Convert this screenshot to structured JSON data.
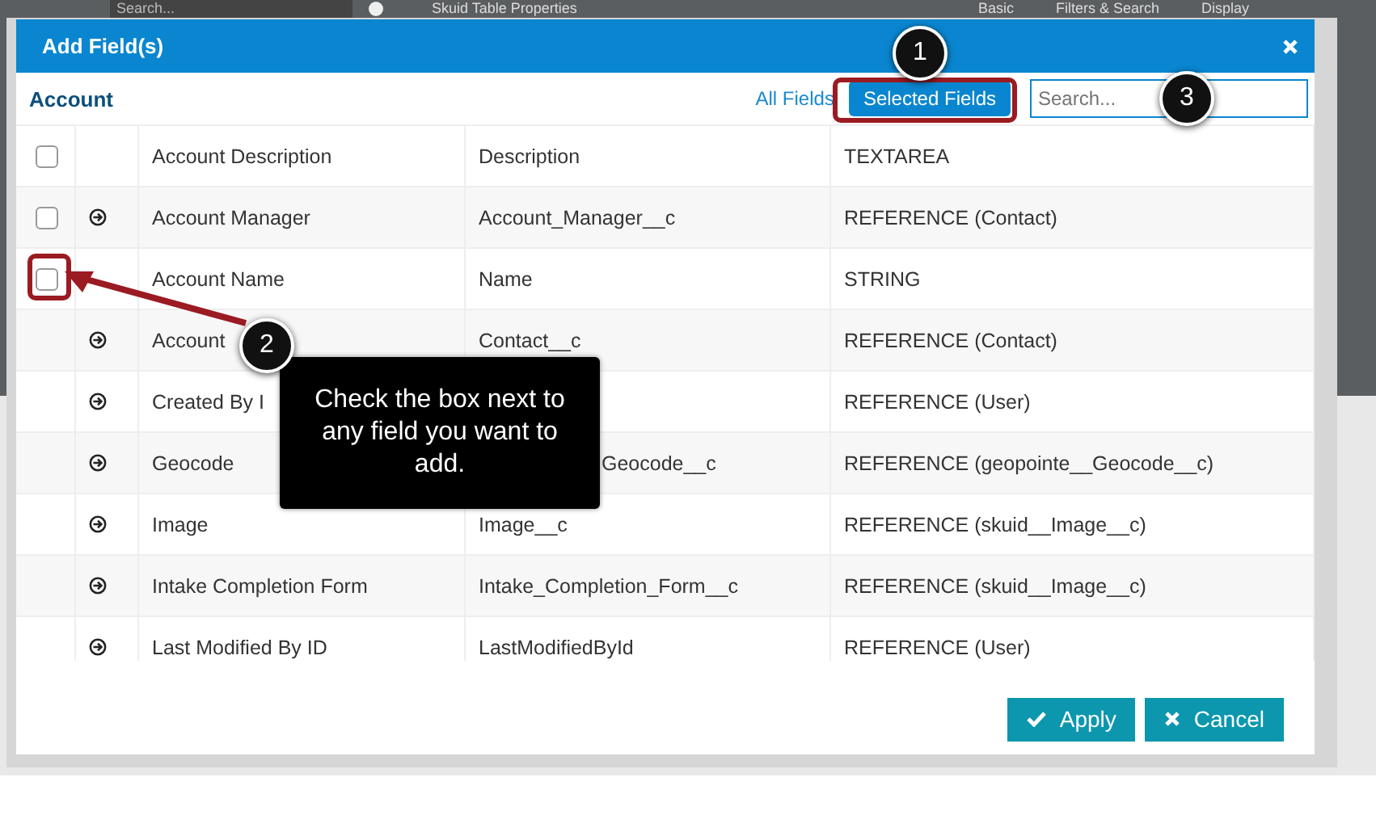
{
  "background": {
    "search_placeholder": "Search...",
    "panel_title": "Skuid Table Properties",
    "tabs": [
      "Basic",
      "Filters & Search",
      "Display"
    ]
  },
  "dialog": {
    "title": "Add Field(s)",
    "object": "Account",
    "filters": [
      {
        "label": "All Fields",
        "selected": false
      },
      {
        "label": "Selected Fields",
        "selected": true
      }
    ],
    "search": {
      "placeholder": "Search..."
    },
    "rows": [
      {
        "name": "Account Description",
        "description": "Description",
        "type": "TEXTAREA",
        "has_checkbox": true,
        "checked": false,
        "expandable": false
      },
      {
        "name": "Account Manager",
        "description": "Account_Manager__c",
        "type": "REFERENCE (Contact)",
        "has_checkbox": true,
        "checked": false,
        "expandable": true
      },
      {
        "name": "Account Name",
        "description": "Name",
        "type": "STRING",
        "has_checkbox": true,
        "checked": false,
        "expandable": false
      },
      {
        "name": "Account",
        "description": "Contact__c",
        "type": "REFERENCE (Contact)",
        "has_checkbox": false,
        "checked": false,
        "expandable": true
      },
      {
        "name": "Created By I",
        "type": "REFERENCE (User)",
        "has_checkbox": false,
        "checked": false,
        "expandable": true
      },
      {
        "name": "Geocode",
        "description": "Geocode__c",
        "description_cut": true,
        "type": "REFERENCE (geopointe__Geocode__c)",
        "has_checkbox": false,
        "checked": false,
        "expandable": true
      },
      {
        "name": "Image",
        "description": "Image__c",
        "type": "REFERENCE (skuid__Image__c)",
        "has_checkbox": false,
        "checked": false,
        "expandable": true
      },
      {
        "name": "Intake Completion Form",
        "description": "Intake_Completion_Form__c",
        "type": "REFERENCE (skuid__Image__c)",
        "has_checkbox": false,
        "checked": false,
        "expandable": true
      },
      {
        "name": "Last Modified By ID",
        "description": "LastModifiedById",
        "type": "REFERENCE (User)",
        "has_checkbox": false,
        "checked": false,
        "expandable": true
      }
    ],
    "buttons": [
      {
        "label": "Apply",
        "kind": "apply"
      },
      {
        "label": "Cancel",
        "kind": "cancel"
      }
    ]
  },
  "annotations": [
    {
      "number": "1"
    },
    {
      "number": "2",
      "text": "Check the box next to any field you want to add."
    },
    {
      "number": "3"
    }
  ]
}
